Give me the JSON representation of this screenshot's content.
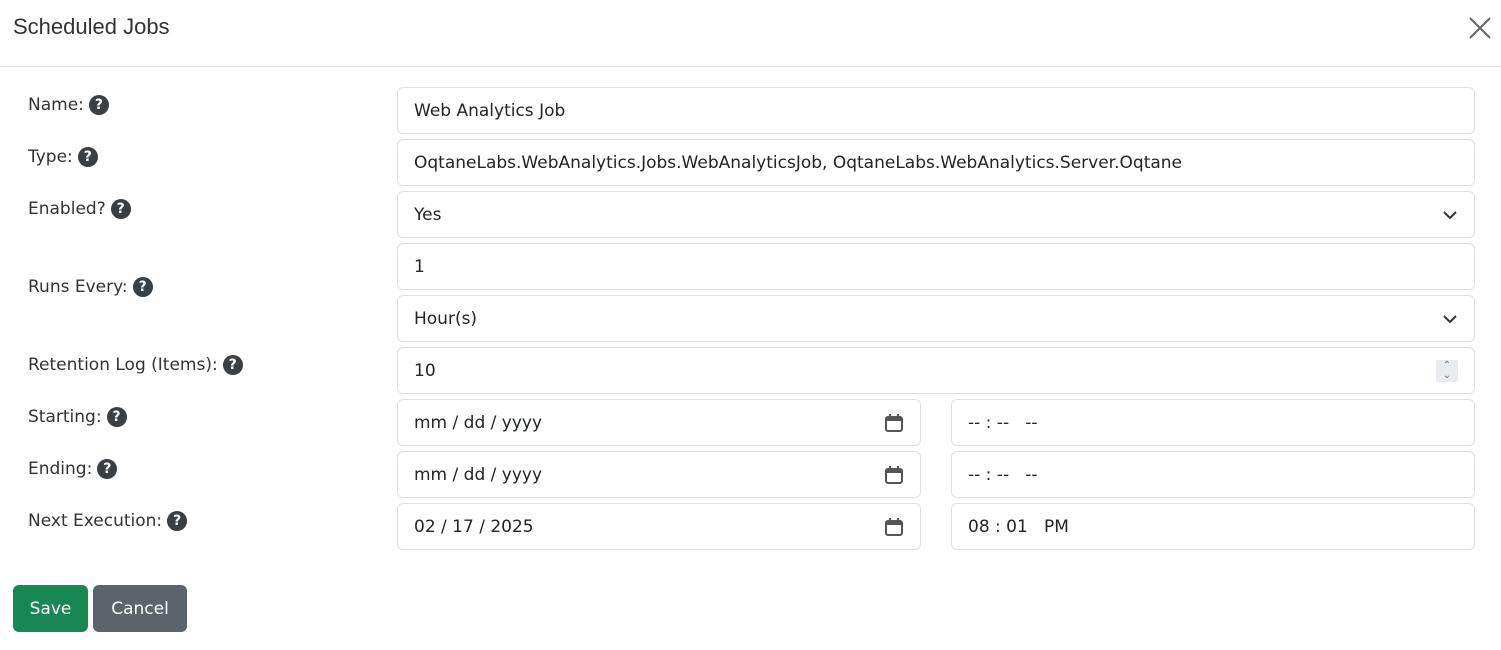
{
  "dialog": {
    "title": "Scheduled Jobs",
    "close_icon": "close-icon"
  },
  "form": {
    "name": {
      "label": "Name:",
      "value": "Web Analytics Job"
    },
    "type": {
      "label": "Type:",
      "value": "OqtaneLabs.WebAnalytics.Jobs.WebAnalyticsJob, OqtaneLabs.WebAnalytics.Server.Oqtane"
    },
    "enabled": {
      "label": "Enabled?",
      "value": "Yes"
    },
    "runs_every": {
      "label": "Runs Every:",
      "value": "1",
      "unit": "Hour(s)"
    },
    "retention": {
      "label": "Retention Log (Items):",
      "value": "10"
    },
    "starting": {
      "label": "Starting:",
      "date": "mm / dd / yyyy",
      "time": "-- : --   --"
    },
    "ending": {
      "label": "Ending:",
      "date": "mm / dd / yyyy",
      "time": "-- : --   --"
    },
    "next_execution": {
      "label": "Next Execution:",
      "date": "02 / 17 / 2025",
      "time": "08 : 01   PM"
    },
    "help_glyph": "?"
  },
  "buttons": {
    "save": "Save",
    "cancel": "Cancel"
  },
  "colors": {
    "save": "#198754",
    "cancel": "#5c636a"
  }
}
